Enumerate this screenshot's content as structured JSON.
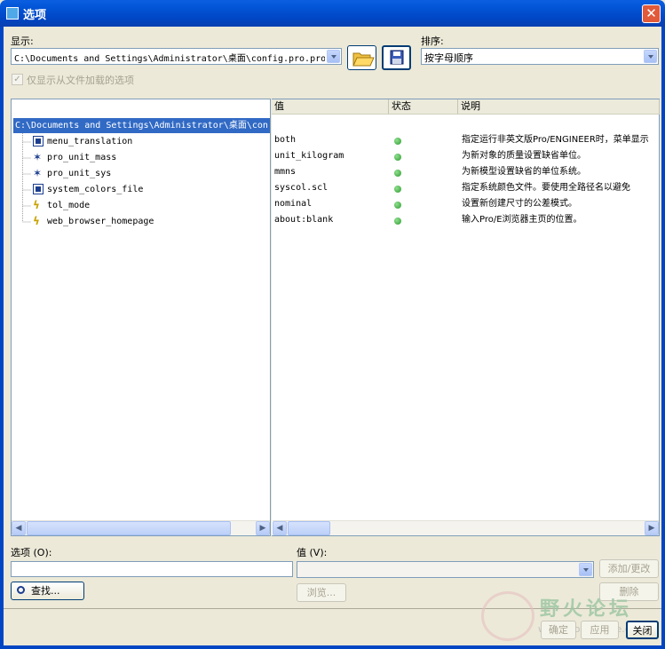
{
  "window": {
    "title": "选项",
    "close_symbol": "✕"
  },
  "display": {
    "label": "显示:",
    "path_value": "C:\\Documents and Settings\\Administrator\\桌面\\config.pro.pro"
  },
  "sort": {
    "label": "排序:",
    "value": "按字母顺序"
  },
  "only_loaded_checkbox": {
    "label": "仅显示从文件加载的选项",
    "checked": true
  },
  "tree": {
    "root": "C:\\Documents and Settings\\Administrator\\桌面\\con",
    "items": [
      {
        "name": "menu_translation",
        "icon": "box-icon"
      },
      {
        "name": "pro_unit_mass",
        "icon": "star-icon"
      },
      {
        "name": "pro_unit_sys",
        "icon": "star-icon"
      },
      {
        "name": "system_colors_file",
        "icon": "box-icon"
      },
      {
        "name": "tol_mode",
        "icon": "lightning-icon"
      },
      {
        "name": "web_browser_homepage",
        "icon": "lightning-icon"
      }
    ]
  },
  "table": {
    "headers": {
      "value": "值",
      "status": "状态",
      "desc": "说明"
    },
    "rows": [
      {
        "value": "both",
        "desc": "指定运行非英文版Pro/ENGINEER时，菜单显示"
      },
      {
        "value": "unit_kilogram",
        "desc": "为新对象的质量设置缺省单位。"
      },
      {
        "value": "mmns",
        "desc": "为新模型设置缺省的单位系统。"
      },
      {
        "value": "syscol.scl",
        "desc": "指定系统颜色文件。要使用全路径名以避免"
      },
      {
        "value": "nominal",
        "desc": "设置新创建尺寸的公差模式。"
      },
      {
        "value": "about:blank",
        "desc": "输入Pro/E浏览器主页的位置。"
      }
    ],
    "status_color": "#2e9a2e"
  },
  "option_field": {
    "label": "选项 (O):",
    "value": ""
  },
  "value_field": {
    "label": "值 (V):",
    "value": ""
  },
  "buttons": {
    "find": "查找...",
    "browse": "浏览...",
    "add_change": "添加/更改",
    "delete": "删除",
    "ok": "确定",
    "apply": "应用",
    "close": "关闭"
  },
  "watermark": {
    "text": "野火论坛",
    "url": "www.proewildfire.cn"
  }
}
